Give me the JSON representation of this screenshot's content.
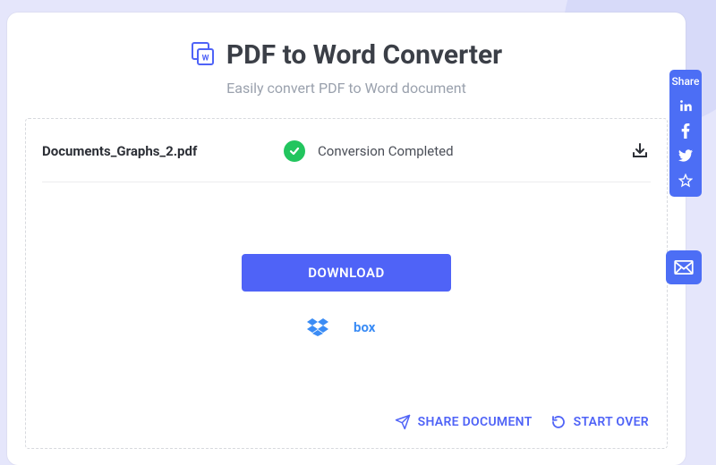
{
  "header": {
    "title": "PDF to Word Converter",
    "subtitle": "Easily convert PDF to Word document"
  },
  "file": {
    "name": "Documents_Graphs_2.pdf",
    "status": "Conversion Completed"
  },
  "actions": {
    "download": "DOWNLOAD",
    "share_document": "SHARE DOCUMENT",
    "start_over": "START OVER"
  },
  "share": {
    "label": "Share"
  }
}
